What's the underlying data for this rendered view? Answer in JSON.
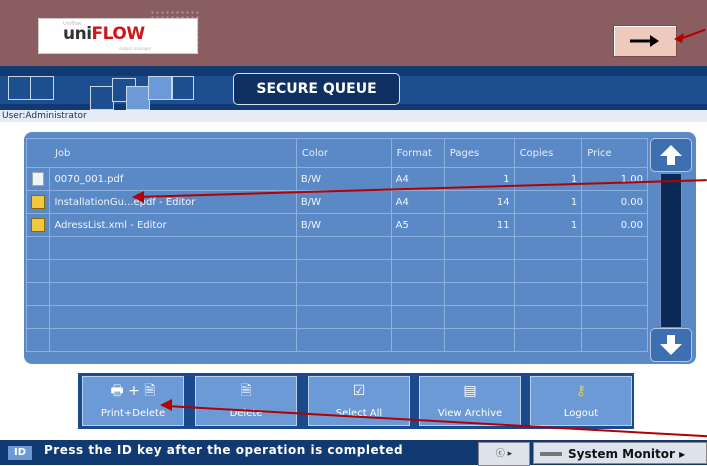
{
  "header": {
    "logo_sub": "Uniflow",
    "logo_uni": "uni",
    "logo_flow": "FLOW",
    "logo_tag": "output manager",
    "arrow_label": "→"
  },
  "nav": {
    "title": "SECURE QUEUE",
    "user_line": "User:Administrator"
  },
  "table": {
    "columns": [
      "Job",
      "Color",
      "Format",
      "Pages",
      "Copies",
      "Price"
    ],
    "rows": [
      {
        "icon": "document-icon",
        "job": "0070_001.pdf",
        "color": "B/W",
        "format": "A4",
        "pages": "1",
        "copies": "1",
        "price": "1.00"
      },
      {
        "icon": "locked-document-icon",
        "job": "InstallationGu...epdf - Editor",
        "color": "B/W",
        "format": "A4",
        "pages": "14",
        "copies": "1",
        "price": "0.00"
      },
      {
        "icon": "locked-document-icon",
        "job": "AdressList.xml - Editor",
        "color": "B/W",
        "format": "A5",
        "pages": "11",
        "copies": "1",
        "price": "0.00"
      }
    ]
  },
  "buttons": {
    "print_delete": "Print+Delete",
    "delete": "Delete",
    "select_all": "Select All",
    "view_archive": "View Archive",
    "logout": "Logout"
  },
  "status": {
    "id_label": "ID",
    "message": "Press the ID key after the operation is completed",
    "counter_label": "ⓒ",
    "system_monitor": "System Monitor"
  },
  "colors": {
    "accent": "#1d4f90",
    "panel": "#5a89c6",
    "annotation_arrow": "#b30000"
  }
}
